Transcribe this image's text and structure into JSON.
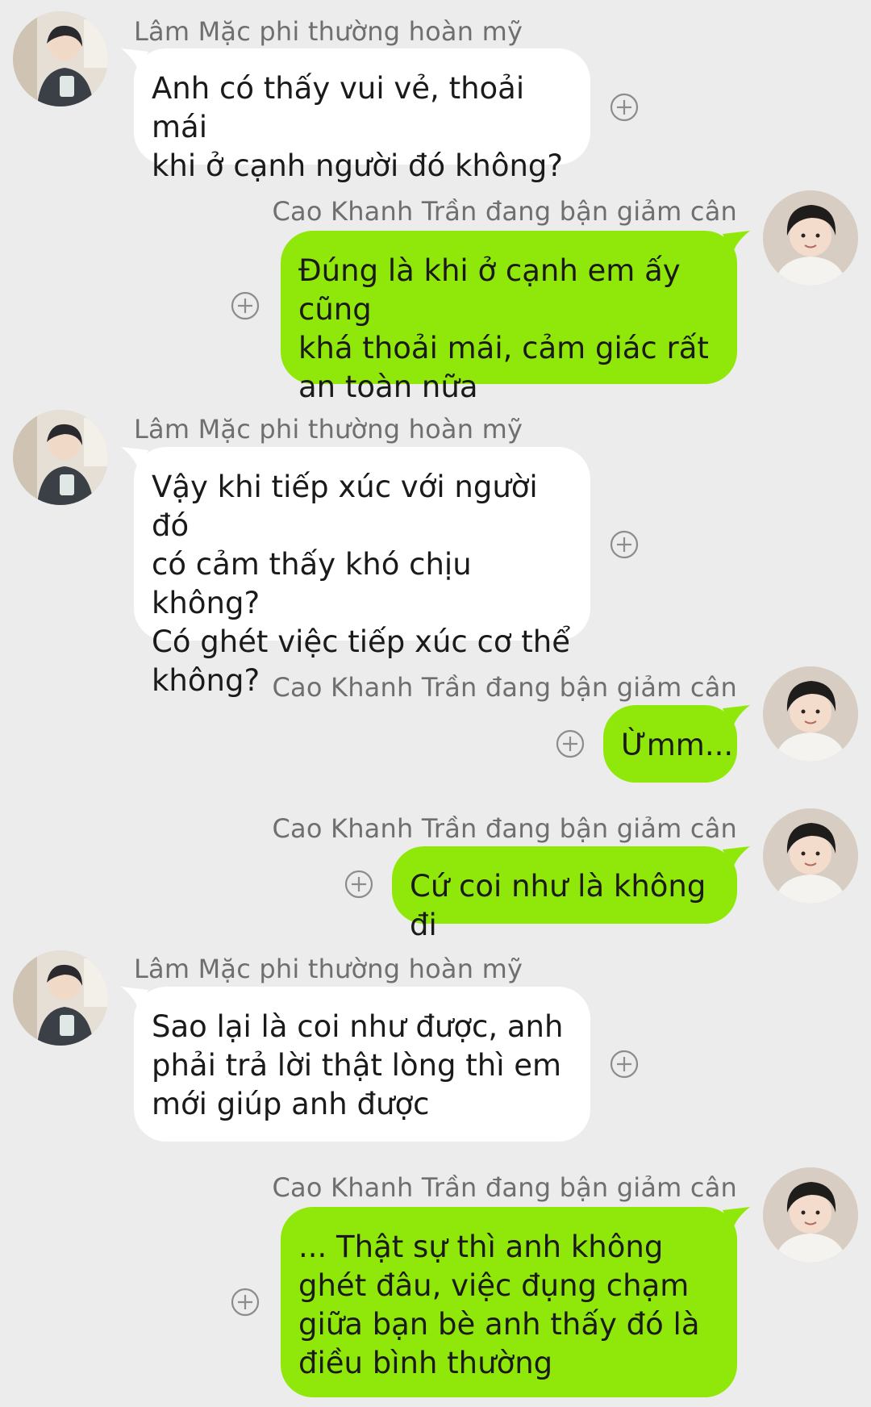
{
  "colors": {
    "background": "#ececec",
    "left_bubble": "#ffffff",
    "right_bubble": "#90e80a",
    "name_text": "#6f6f6f",
    "message_text": "#1a1a1a"
  },
  "participants": {
    "left_name": "Lâm Mặc phi thường hoàn mỹ",
    "right_name": "Cao Khanh Trần đang bận giảm cân"
  },
  "messages": [
    {
      "side": "left",
      "name": "Lâm Mặc phi thường hoàn mỹ",
      "text": "Anh có thấy vui vẻ, thoải mái\nkhi ở cạnh người đó không?",
      "avatar_icon": "profile-photo-icon",
      "action_icon": "add-circle-icon"
    },
    {
      "side": "right",
      "name": "Cao Khanh Trần đang bận giảm cân",
      "text": "Đúng là khi ở cạnh em ấy cũng\nkhá thoải mái, cảm giác rất\nan toàn nữa",
      "avatar_icon": "profile-photo-icon",
      "action_icon": "add-circle-icon"
    },
    {
      "side": "left",
      "name": "Lâm Mặc phi thường hoàn mỹ",
      "text": "Vậy khi tiếp xúc với người đó\ncó cảm thấy khó chịu không?\nCó ghét việc tiếp xúc cơ thể\nkhông?",
      "avatar_icon": "profile-photo-icon",
      "action_icon": "add-circle-icon"
    },
    {
      "side": "right",
      "name": "Cao Khanh Trần đang bận giảm cân",
      "text": "Ừmm...",
      "avatar_icon": "profile-photo-icon",
      "action_icon": "add-circle-icon"
    },
    {
      "side": "right",
      "name": "Cao Khanh Trần đang bận giảm cân",
      "text": "Cứ coi như là không đi",
      "avatar_icon": "profile-photo-icon",
      "action_icon": "add-circle-icon"
    },
    {
      "side": "left",
      "name": "Lâm Mặc phi thường hoàn mỹ",
      "text": "Sao lại là coi như được, anh\nphải trả lời thật lòng thì em\nmới giúp anh được",
      "avatar_icon": "profile-photo-icon",
      "action_icon": "add-circle-icon"
    },
    {
      "side": "right",
      "name": "Cao Khanh Trần đang bận giảm cân",
      "text": "... Thật sự thì anh không\nghét đâu, việc đụng chạm\ngiữa bạn bè anh thấy đó là\nđiều bình thường",
      "avatar_icon": "profile-photo-icon",
      "action_icon": "add-circle-icon"
    }
  ]
}
